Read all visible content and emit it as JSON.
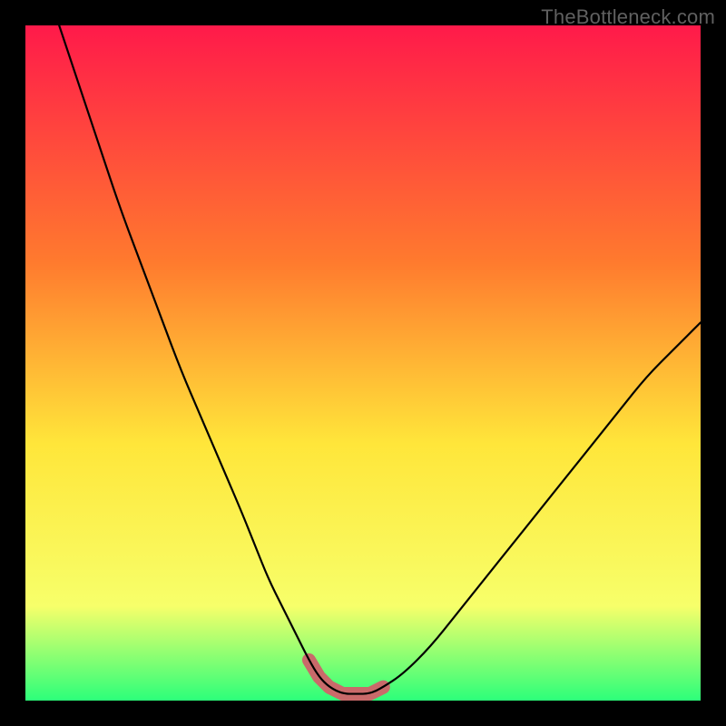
{
  "watermark": "TheBottleneck.com",
  "colors": {
    "bg": "#000000",
    "gradient_top": "#ff1a4a",
    "gradient_mid1": "#ff7a2e",
    "gradient_mid2": "#ffe63a",
    "gradient_mid3": "#f7ff6a",
    "gradient_bot": "#2cff7a",
    "curve": "#000000",
    "highlight": "#c96a6a"
  },
  "chart_data": {
    "type": "line",
    "title": "",
    "xlabel": "",
    "ylabel": "",
    "xlim": [
      0,
      100
    ],
    "ylim": [
      0,
      100
    ],
    "series": [
      {
        "name": "bottleneck-curve",
        "x": [
          5,
          8,
          11,
          14,
          17,
          20,
          23,
          26,
          29,
          32,
          34,
          36,
          38,
          40,
          42,
          43.5,
          45,
          47,
          49,
          51,
          53,
          56,
          60,
          64,
          68,
          72,
          76,
          80,
          84,
          88,
          92,
          96,
          100
        ],
        "values": [
          100,
          91,
          82,
          73,
          65,
          57,
          49,
          42,
          35,
          28,
          23,
          18,
          14,
          10,
          6,
          3.5,
          2,
          1,
          1,
          1,
          2,
          4,
          8,
          13,
          18,
          23,
          28,
          33,
          38,
          43,
          48,
          52,
          56
        ]
      }
    ],
    "highlight_region": {
      "x_start": 38,
      "x_end": 55,
      "y_max": 6
    },
    "legend": false,
    "grid": false
  }
}
